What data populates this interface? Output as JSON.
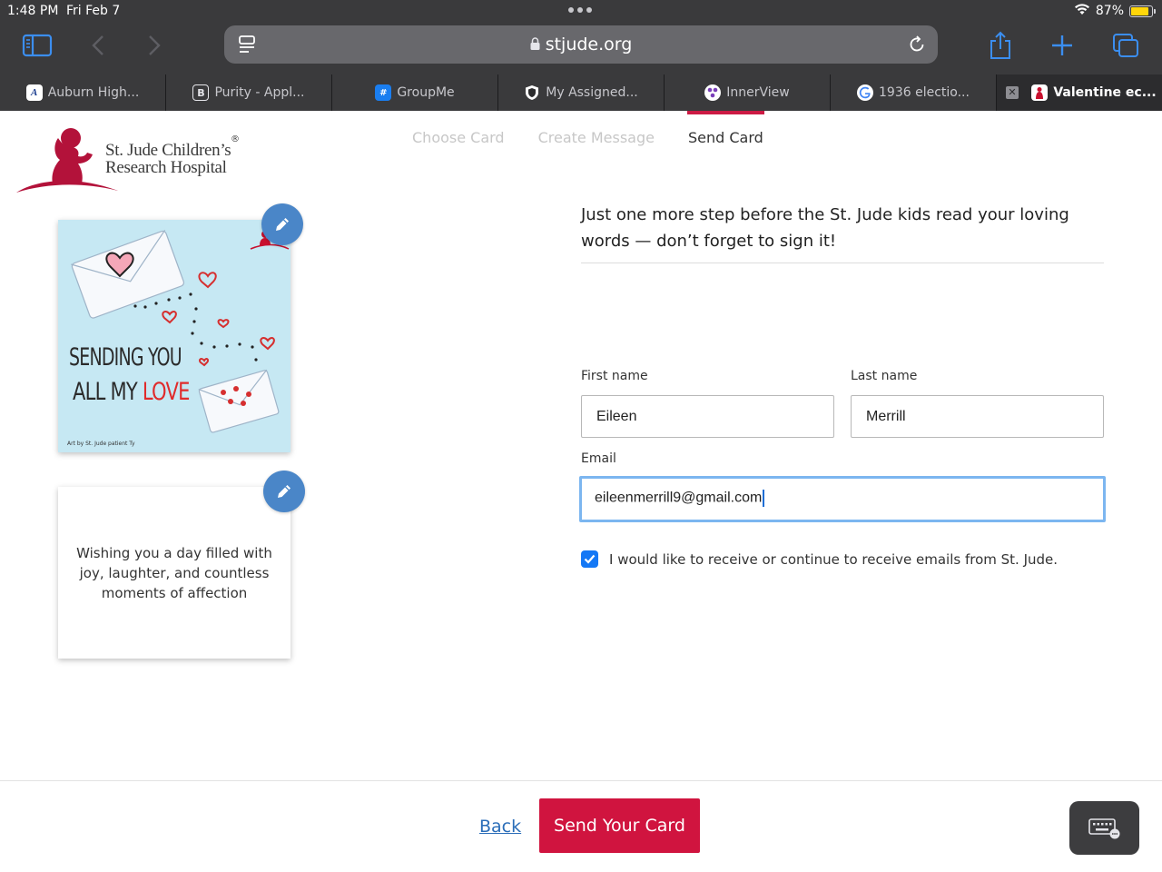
{
  "status": {
    "time": "1:48 PM",
    "date": "Fri Feb 7",
    "battery": "87%"
  },
  "browser": {
    "url": "stjude.org",
    "tabs": [
      {
        "label": "Auburn High...",
        "icon": "auburn-icon",
        "active": false
      },
      {
        "label": "Purity - Appl...",
        "icon": "letter-b-icon",
        "active": false
      },
      {
        "label": "GroupMe",
        "icon": "groupme-icon",
        "active": false
      },
      {
        "label": "My Assigned...",
        "icon": "shield-icon",
        "active": false
      },
      {
        "label": "InnerView",
        "icon": "innerview-icon",
        "active": false
      },
      {
        "label": "1936 electio...",
        "icon": "google-icon",
        "active": false
      },
      {
        "label": "Valentine ec...",
        "icon": "stjude-icon",
        "active": true
      }
    ]
  },
  "logo": {
    "line1": "St. Jude Children’s",
    "line2": "Research Hospital",
    "mark": "®"
  },
  "steps": [
    {
      "label": "Choose Card",
      "active": false
    },
    {
      "label": "Create Message",
      "active": false
    },
    {
      "label": "Send Card",
      "active": true
    }
  ],
  "card": {
    "front_line1": "SENDING YOU",
    "front_line2a": "ALL MY ",
    "front_line2b": "LOVE",
    "credit": "Art by St. Jude patient Ty",
    "message": "Wishing you a day filled with joy, laughter, and countless moments of affection"
  },
  "form": {
    "intro": "Just one more step before the St. Jude kids read your loving words — don’t forget to sign it!",
    "first_name_label": "First name",
    "first_name_value": "Eileen",
    "last_name_label": "Last name",
    "last_name_value": "Merrill",
    "email_label": "Email",
    "email_value": "eileenmerrill9@gmail.com",
    "opt_in_label": "I would like to receive or continue to receive emails from St. Jude.",
    "opt_in_checked": true
  },
  "footer": {
    "back_label": "Back",
    "send_label": "Send Your Card"
  },
  "colors": {
    "brand_red": "#d0143f",
    "edit_blue": "#4a86c8",
    "focus_blue": "#7cb6f0",
    "checkbox_blue": "#1478f5"
  }
}
